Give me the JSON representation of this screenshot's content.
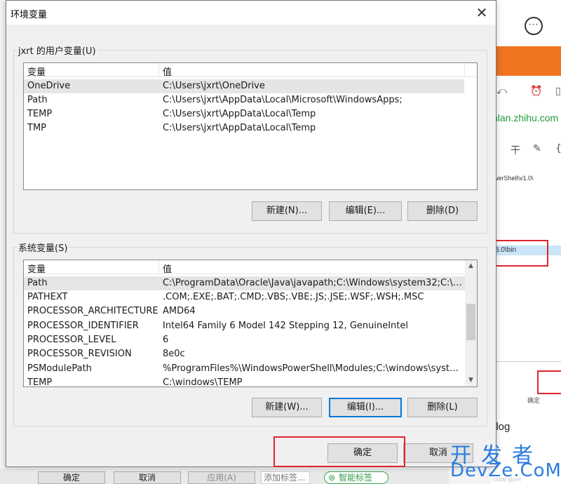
{
  "dialog": {
    "title": "环境变量",
    "close_glyph": "✕"
  },
  "user_vars": {
    "group_label": "jxrt 的用户变量(U)",
    "col_name": "变量",
    "col_value": "值",
    "rows": [
      {
        "name": "OneDrive",
        "value": "C:\\Users\\jxrt\\OneDrive"
      },
      {
        "name": "Path",
        "value": "C:\\Users\\jxrt\\AppData\\Local\\Microsoft\\WindowsApps;"
      },
      {
        "name": "TEMP",
        "value": "C:\\Users\\jxrt\\AppData\\Local\\Temp"
      },
      {
        "name": "TMP",
        "value": "C:\\Users\\jxrt\\AppData\\Local\\Temp"
      }
    ],
    "selected_row": 0,
    "new_label": "新建(N)...",
    "edit_label": "编辑(E)...",
    "delete_label": "删除(D)"
  },
  "system_vars": {
    "group_label": "系统变量(S)",
    "col_name": "变量",
    "col_value": "值",
    "rows": [
      {
        "name": "Path",
        "value": "C:\\ProgramData\\Oracle\\Java\\javapath;C:\\Windows\\system32;C:\\Wi..."
      },
      {
        "name": "PATHEXT",
        "value": ".COM;.EXE;.BAT;.CMD;.VBS;.VBE;.JS;.JSE;.WSF;.WSH;.MSC"
      },
      {
        "name": "PROCESSOR_ARCHITECTURE",
        "value": "AMD64"
      },
      {
        "name": "PROCESSOR_IDENTIFIER",
        "value": "Intel64 Family 6 Model 142 Stepping 12, GenuineIntel"
      },
      {
        "name": "PROCESSOR_LEVEL",
        "value": "6"
      },
      {
        "name": "PROCESSOR_REVISION",
        "value": "8e0c"
      },
      {
        "name": "PSModulePath",
        "value": "%ProgramFiles%\\WindowsPowerShell\\Modules;C:\\windows\\syste..."
      },
      {
        "name": "TEMP",
        "value": "C:\\windows\\TEMP"
      }
    ],
    "selected_row": 0,
    "new_label": "新建(W)...",
    "edit_label": "编辑(I)...",
    "delete_label": "删除(L)"
  },
  "footer": {
    "ok_label": "确定",
    "cancel_label": "取消"
  },
  "background": {
    "url_fragment": "nlan.zhihu.com",
    "path_fragment": "werShell\\v1.0\\",
    "bin_fragment": "5.0\\bin",
    "llog_text": "llog",
    "ok_label": "确定",
    "cancel_label": "取消",
    "apply_label": "应用(A)",
    "tag_placeholder": "添加标签...",
    "smart_tag_label": "智能标签",
    "ok_small": "确定",
    "accent_color": "#f0731f",
    "highlight_color": "#e0242b"
  },
  "watermark": {
    "line1": "开发者",
    "line2": "DevZe.CoM",
    "small": "CSDN @jxrt"
  }
}
